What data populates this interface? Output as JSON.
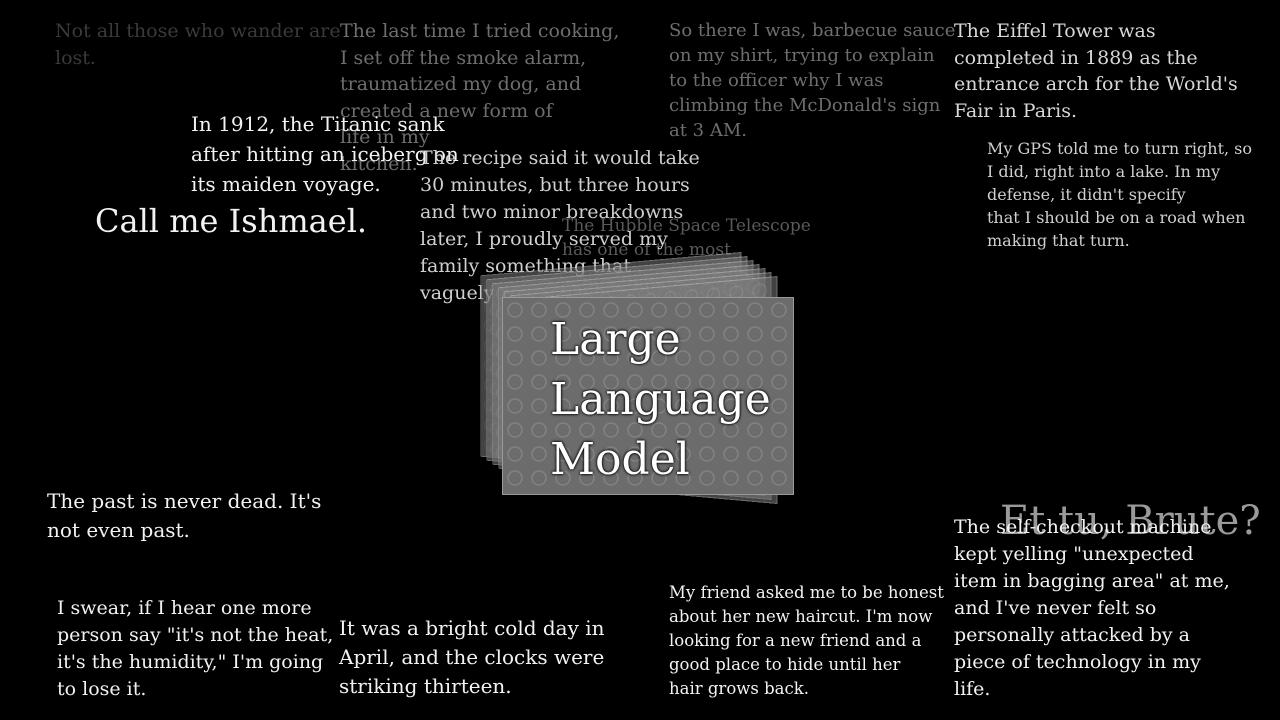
{
  "center_label": "Large\nLanguage\nModel",
  "snippets": {
    "s_top_left_faint": "Not all those who wander are\nlost.",
    "s_cooking": "The last time I tried cooking,\nI set off the smoke alarm,\ntraumatized my dog, and\ncreated a new form of\nlife in my\nkitchen.",
    "s_bbq": "So there I was, barbecue sauce\non my shirt, trying to explain\nto the officer why I was\nclimbing the McDonald's sign\nat 3 AM.",
    "s_eiffel": "The Eiffel Tower was\ncompleted in 1889 as the\nentrance arch for the World's\nFair in Paris.",
    "s_titanic": "In 1912, the Titanic sank\nafter hitting an iceberg on\nits maiden voyage.",
    "s_recipe": "The recipe said it would take\n30 minutes, but three hours\nand two minor breakdowns\nlater, I proudly served my\nfamily something that\nvaguely resembled food",
    "s_gps": "My GPS told me to turn right, so\nI did, right into a lake. In my\ndefense, it didn't specify\nthat I should be on a road when\nmaking that turn.",
    "s_ishmael": "Call me Ishmael.",
    "s_hubble": "The Hubble Space Telescope\nhas one of the most",
    "s_past": "The past is never dead. It's\nnot even past.",
    "s_brute": "Et tu, Brute?",
    "s_checkout": "The self-checkout machine\nkept yelling \"unexpected\nitem in bagging area\" at me,\nand I've never felt so\npersonally attacked by a\npiece of technology in my\nlife.",
    "s_humidity": "I swear, if I hear one more\nperson say \"it's not the heat,\nit's the humidity,\" I'm going\nto lose it.",
    "s_orwell": "It was a bright cold day in\nApril, and the clocks were\nstriking thirteen.",
    "s_haircut": "My friend asked me to be honest\nabout her new haircut. I'm now\nlooking for a new friend and a\ngood place to hide until her\nhair grows back."
  }
}
